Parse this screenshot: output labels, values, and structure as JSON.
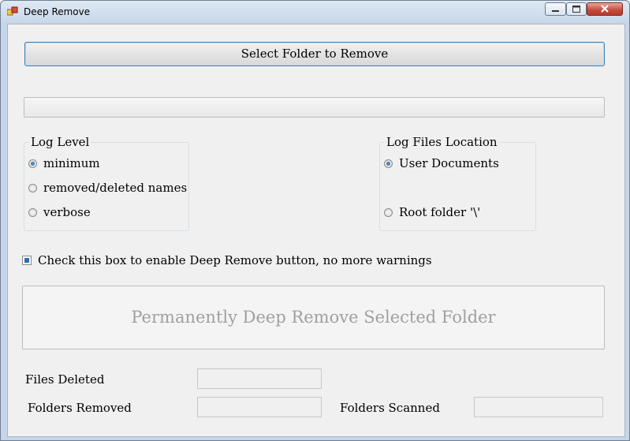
{
  "window": {
    "title": "Deep Remove",
    "icons": {
      "app": "app-icon",
      "minimize": "minimize-icon",
      "maximize": "maximize-icon",
      "close": "close-icon"
    }
  },
  "select_button": {
    "label": "Select Folder to Remove"
  },
  "progress": {
    "value": 0
  },
  "log_level": {
    "legend": "Log Level",
    "options": [
      "minimum",
      "removed/deleted names",
      "verbose"
    ],
    "selected": "minimum"
  },
  "log_location": {
    "legend": "Log Files Location",
    "options": [
      "User Documents",
      "Root folder '\\'"
    ],
    "selected": "User Documents"
  },
  "enable_checkbox": {
    "label": "Check this box to enable Deep Remove button, no more warnings",
    "checked": true
  },
  "deep_remove_button": {
    "label": "Permanently Deep Remove Selected Folder",
    "enabled": false
  },
  "stats": {
    "files_deleted_label": "Files Deleted",
    "files_deleted_value": "",
    "folders_removed_label": "Folders Removed",
    "folders_removed_value": "",
    "folders_scanned_label": "Folders Scanned",
    "folders_scanned_value": ""
  },
  "colors": {
    "accent": "#3c7fb1",
    "disabled_text": "#a0a0a0",
    "close_button": "#c6473a"
  }
}
